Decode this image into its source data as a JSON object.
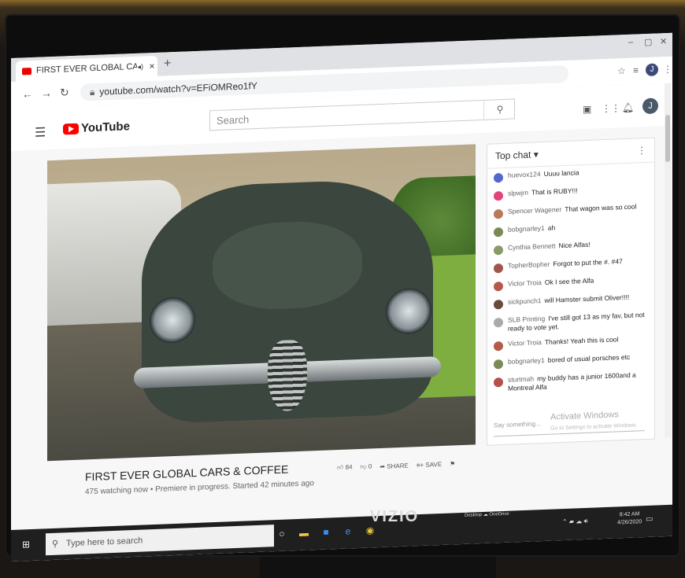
{
  "browser": {
    "tab_title": "FIRST EVER GLOBAL CARS &",
    "tab_audio_icon": "speaker-icon",
    "tab_close": "×",
    "new_tab": "+",
    "url": "youtube.com/watch?v=EFiOMReo1fY"
  },
  "youtube": {
    "logo_text": "YouTube",
    "search_placeholder": "Search",
    "avatar_letter": "J"
  },
  "video": {
    "title": "FIRST EVER GLOBAL CARS & COFFEE",
    "meta": "475 watching now • Premiere in progress. Started 42 minutes ago",
    "likes": "84",
    "dislikes": "0",
    "share_label": "SHARE",
    "save_label": "SAVE"
  },
  "chat": {
    "header": "Top chat ▾",
    "messages": [
      {
        "author": "huevox124",
        "text": "Uuuu lancia",
        "color": "#5566cc"
      },
      {
        "author": "slpwjm",
        "text": "That is RUBY!!!",
        "color": "#e0457b"
      },
      {
        "author": "Spencer Wagener",
        "text": "That wagon was so cool",
        "color": "#b97a5a"
      },
      {
        "author": "bobgnarley1",
        "text": "ah",
        "color": "#7b8a55"
      },
      {
        "author": "Cynthia Bennett",
        "text": "Nice Alfas!",
        "color": "#8a9a6a"
      },
      {
        "author": "TopherBopher",
        "text": "Forgot to put the #. #47",
        "color": "#a0564a"
      },
      {
        "author": "Victor Troia",
        "text": "Ok I see the Alfa",
        "color": "#b55a4a"
      },
      {
        "author": "sickpunch1",
        "text": "will Hamster submit Oliver!!!!",
        "color": "#6a4a3a"
      },
      {
        "author": "SLB Printing",
        "text": "I've still got 13 as my fav, but not ready to vote yet.",
        "color": "#aaaaaa"
      },
      {
        "author": "Victor Troia",
        "text": "Thanks! Yeah this is cool",
        "color": "#b55a4a"
      },
      {
        "author": "bobgnarley1",
        "text": "bored of usual porsches etc",
        "color": "#7b8a55"
      },
      {
        "author": "sturtmah",
        "text": "my buddy has a junior 1600and a Montreal Alfa",
        "color": "#b5504a"
      }
    ],
    "input_placeholder": "Say something...",
    "activate_title": "Activate Windows",
    "activate_sub": "Go to Settings to activate Windows."
  },
  "taskbar": {
    "search_placeholder": "Type here to search",
    "desktop_label": "Desktop",
    "onedrive_label": "OneDrive",
    "time": "8:42 AM",
    "date": "4/26/2020"
  },
  "monitor": {
    "brand": "VIZIO"
  }
}
